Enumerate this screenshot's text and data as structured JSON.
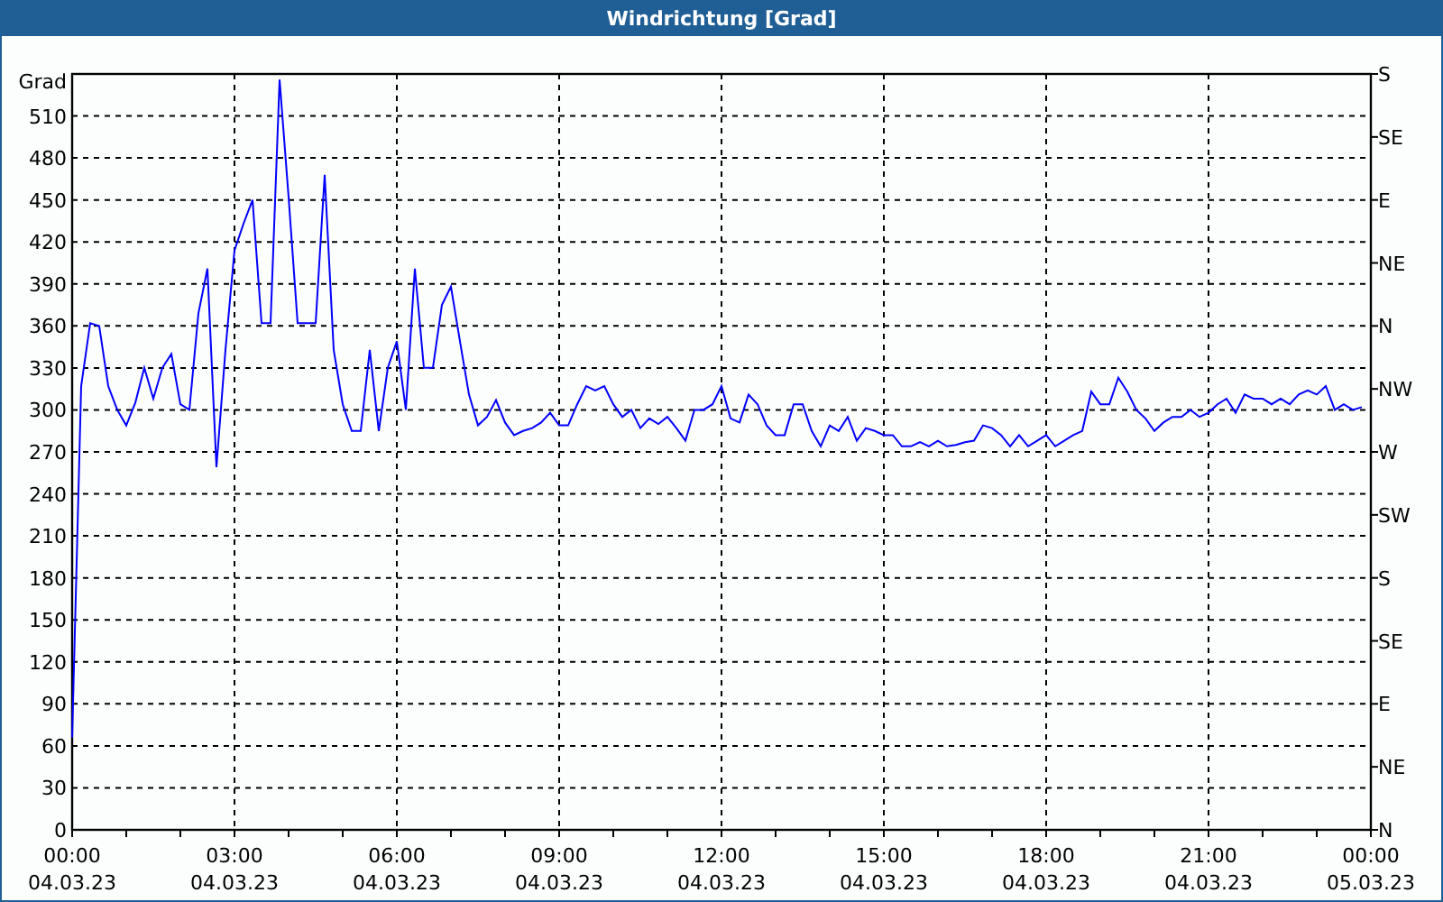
{
  "window": {
    "title": "Windrichtung [Grad]"
  },
  "chart_data": {
    "type": "line",
    "grid": true,
    "ylabel": "Grad",
    "xlim": [
      0,
      1440
    ],
    "ylim": [
      0,
      540
    ],
    "xticks": [
      {
        "value": 0,
        "label": "00:00"
      },
      {
        "value": 180,
        "label": "03:00"
      },
      {
        "value": 360,
        "label": "06:00"
      },
      {
        "value": 540,
        "label": "09:00"
      },
      {
        "value": 720,
        "label": "12:00"
      },
      {
        "value": 900,
        "label": "15:00"
      },
      {
        "value": 1080,
        "label": "18:00"
      },
      {
        "value": 1260,
        "label": "21:00"
      }
    ],
    "yticks": [
      0,
      30,
      60,
      90,
      120,
      150,
      180,
      210,
      240,
      270,
      300,
      330,
      360,
      390,
      420,
      450,
      480,
      510
    ],
    "x": [
      0,
      10,
      20,
      30,
      40,
      50,
      60,
      70,
      80,
      90,
      100,
      110,
      120,
      130,
      140,
      150,
      160,
      170,
      180,
      190,
      200,
      210,
      220,
      230,
      240,
      250,
      260,
      270,
      280,
      290,
      300,
      310,
      320,
      330,
      340,
      350,
      360,
      370,
      380,
      390,
      400,
      410,
      420,
      430,
      440,
      450,
      460,
      470,
      480,
      490,
      500,
      510,
      520,
      530,
      540,
      550,
      560,
      570,
      580,
      590,
      600,
      610,
      620,
      630,
      640,
      650,
      660,
      670,
      680,
      690,
      700,
      710,
      720,
      730,
      740,
      750,
      760,
      770,
      780,
      790,
      800,
      810,
      820,
      830,
      840,
      850,
      860,
      870,
      880,
      890,
      900,
      910,
      920,
      930,
      940,
      950,
      960,
      970,
      980,
      990,
      1000,
      1010,
      1020,
      1030,
      1040,
      1050,
      1060,
      1070,
      1080,
      1090,
      1100,
      1110,
      1120,
      1130,
      1140,
      1150,
      1160,
      1170,
      1180,
      1190,
      1200,
      1210,
      1220,
      1230,
      1240,
      1250,
      1260,
      1270,
      1280,
      1290,
      1300,
      1310,
      1320,
      1330,
      1340,
      1350,
      1360,
      1370,
      1380,
      1390,
      1400,
      1410,
      1420,
      1430
    ],
    "series": [
      {
        "color": "#0000ff",
        "values": [
          66,
          317,
          362,
          360,
          317,
          300,
          289,
          305,
          330,
          308,
          330,
          340,
          304,
          300,
          369,
          401,
          259,
          343,
          414,
          433,
          450,
          362,
          362,
          536,
          452,
          362,
          362,
          362,
          468,
          343,
          304,
          285,
          285,
          343,
          285,
          330,
          349,
          300,
          401,
          330,
          330,
          375,
          388,
          349,
          311,
          289,
          295,
          307,
          291,
          282,
          285,
          287,
          291,
          298,
          289,
          289,
          304,
          317,
          314,
          317,
          304,
          295,
          300,
          287,
          294,
          290,
          295,
          287,
          278,
          300,
          300,
          304,
          317,
          294,
          291,
          311,
          304,
          289,
          282,
          282,
          304,
          304,
          285,
          274,
          289,
          285,
          295,
          278,
          287,
          285,
          282,
          282,
          274,
          274,
          277,
          274,
          278,
          274,
          275,
          277,
          278,
          289,
          287,
          282,
          274,
          282,
          274,
          278,
          282,
          274,
          278,
          282,
          285,
          313,
          304,
          304,
          323,
          313,
          300,
          294,
          285,
          291,
          295,
          295,
          300,
          295,
          298,
          304,
          308,
          298,
          311,
          308,
          308,
          304,
          308,
          304,
          311,
          314,
          311,
          317,
          300,
          304,
          300,
          302
        ]
      }
    ]
  },
  "date_labels": [
    "04.03.23",
    "04.03.23",
    "04.03.23",
    "04.03.23",
    "04.03.23",
    "04.03.23",
    "04.03.23",
    "04.03.23"
  ],
  "axis_end": {
    "time": "00:00",
    "date": "05.03.23"
  },
  "compass_axis": [
    "S",
    "SE",
    "E",
    "NE",
    "N",
    "NW",
    "W",
    "SW",
    "S",
    "SE",
    "E",
    "NE",
    "N"
  ]
}
